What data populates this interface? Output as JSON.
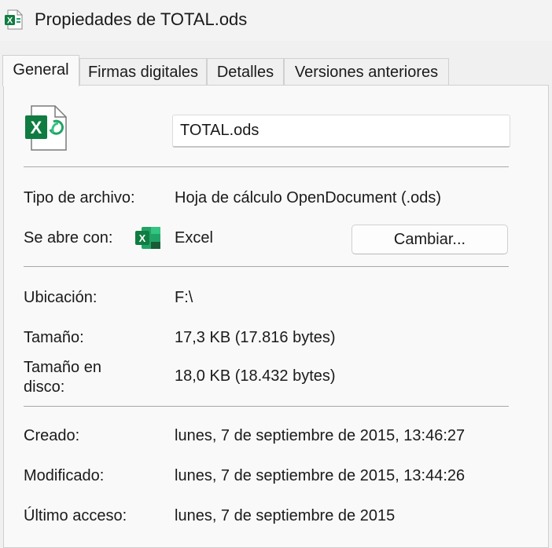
{
  "window": {
    "title": "Propiedades de TOTAL.ods",
    "icon": "spreadsheet-icon"
  },
  "tabs": [
    {
      "label": "General",
      "active": true
    },
    {
      "label": "Firmas digitales",
      "active": false
    },
    {
      "label": "Detalles",
      "active": false
    },
    {
      "label": "Versiones anteriores",
      "active": false
    }
  ],
  "general": {
    "file_name": "TOTAL.ods",
    "file_icon": "excel-file-icon",
    "file_type": {
      "label": "Tipo de archivo:",
      "value": "Hoja de cálculo OpenDocument (.ods)"
    },
    "opens_with": {
      "label": "Se abre con:",
      "value": "Excel",
      "icon": "excel-app-icon",
      "button": "Cambiar..."
    },
    "location": {
      "label": "Ubicación:",
      "value": "F:\\"
    },
    "size": {
      "label": "Tamaño:",
      "value": "17,3 KB (17.816 bytes)"
    },
    "size_on_disk": {
      "label_line1": "Tamaño en",
      "label_line2": "disco:",
      "value": "18,0 KB (18.432 bytes)"
    },
    "created": {
      "label": "Creado:",
      "value": "lunes, 7 de septiembre de 2015, 13:46:27"
    },
    "modified": {
      "label": "Modificado:",
      "value": "lunes, 7 de septiembre de 2015, 13:44:26"
    },
    "accessed": {
      "label": "Último acceso:",
      "value": "lunes, 7 de septiembre de 2015"
    }
  },
  "colors": {
    "excel_green": "#107c41",
    "excel_dark_green": "#185c37",
    "background": "#f0f0f0",
    "panel": "#f9f9f9"
  }
}
